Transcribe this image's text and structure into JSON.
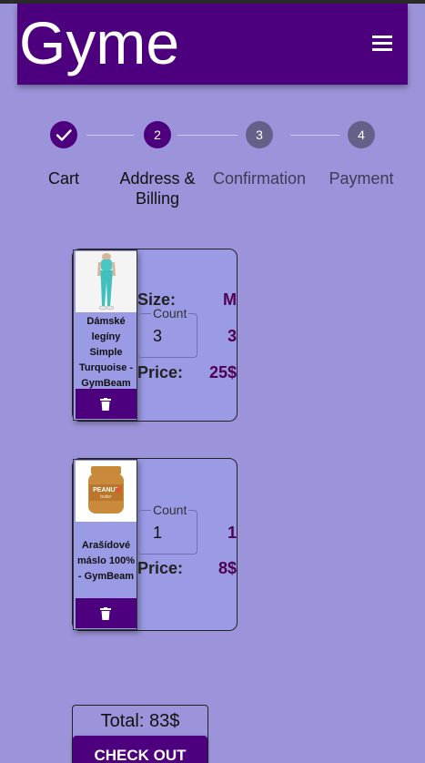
{
  "app": {
    "brand": "Gyme"
  },
  "colors": {
    "primary": "#4d007e",
    "background": "#9c94da",
    "card": "#9a9ae5",
    "value_text": "#500050"
  },
  "stepper": {
    "steps": [
      {
        "label": "Cart",
        "marker": "check-icon",
        "state": "done"
      },
      {
        "label": "Address & Billing",
        "number": "2",
        "state": "current"
      },
      {
        "label": "Confirmation",
        "number": "3",
        "state": "pending"
      },
      {
        "label": "Payment",
        "number": "4",
        "state": "pending"
      }
    ]
  },
  "cart": {
    "items": [
      {
        "name": "Dámské legíny Simple Turquoise - GymBeam",
        "size_label": "Size:",
        "size": "M",
        "count_label": "Count",
        "count": "3",
        "count_display": "3",
        "price_label": "Price:",
        "price": "25$"
      },
      {
        "name": "Arašídové máslo 100% - GymBeam",
        "count_label": "Count",
        "count": "1",
        "count_display": "1",
        "price_label": "Price:",
        "price": "8$"
      }
    ],
    "total": "Total: 83$",
    "checkout_label": "CHECK OUT"
  }
}
